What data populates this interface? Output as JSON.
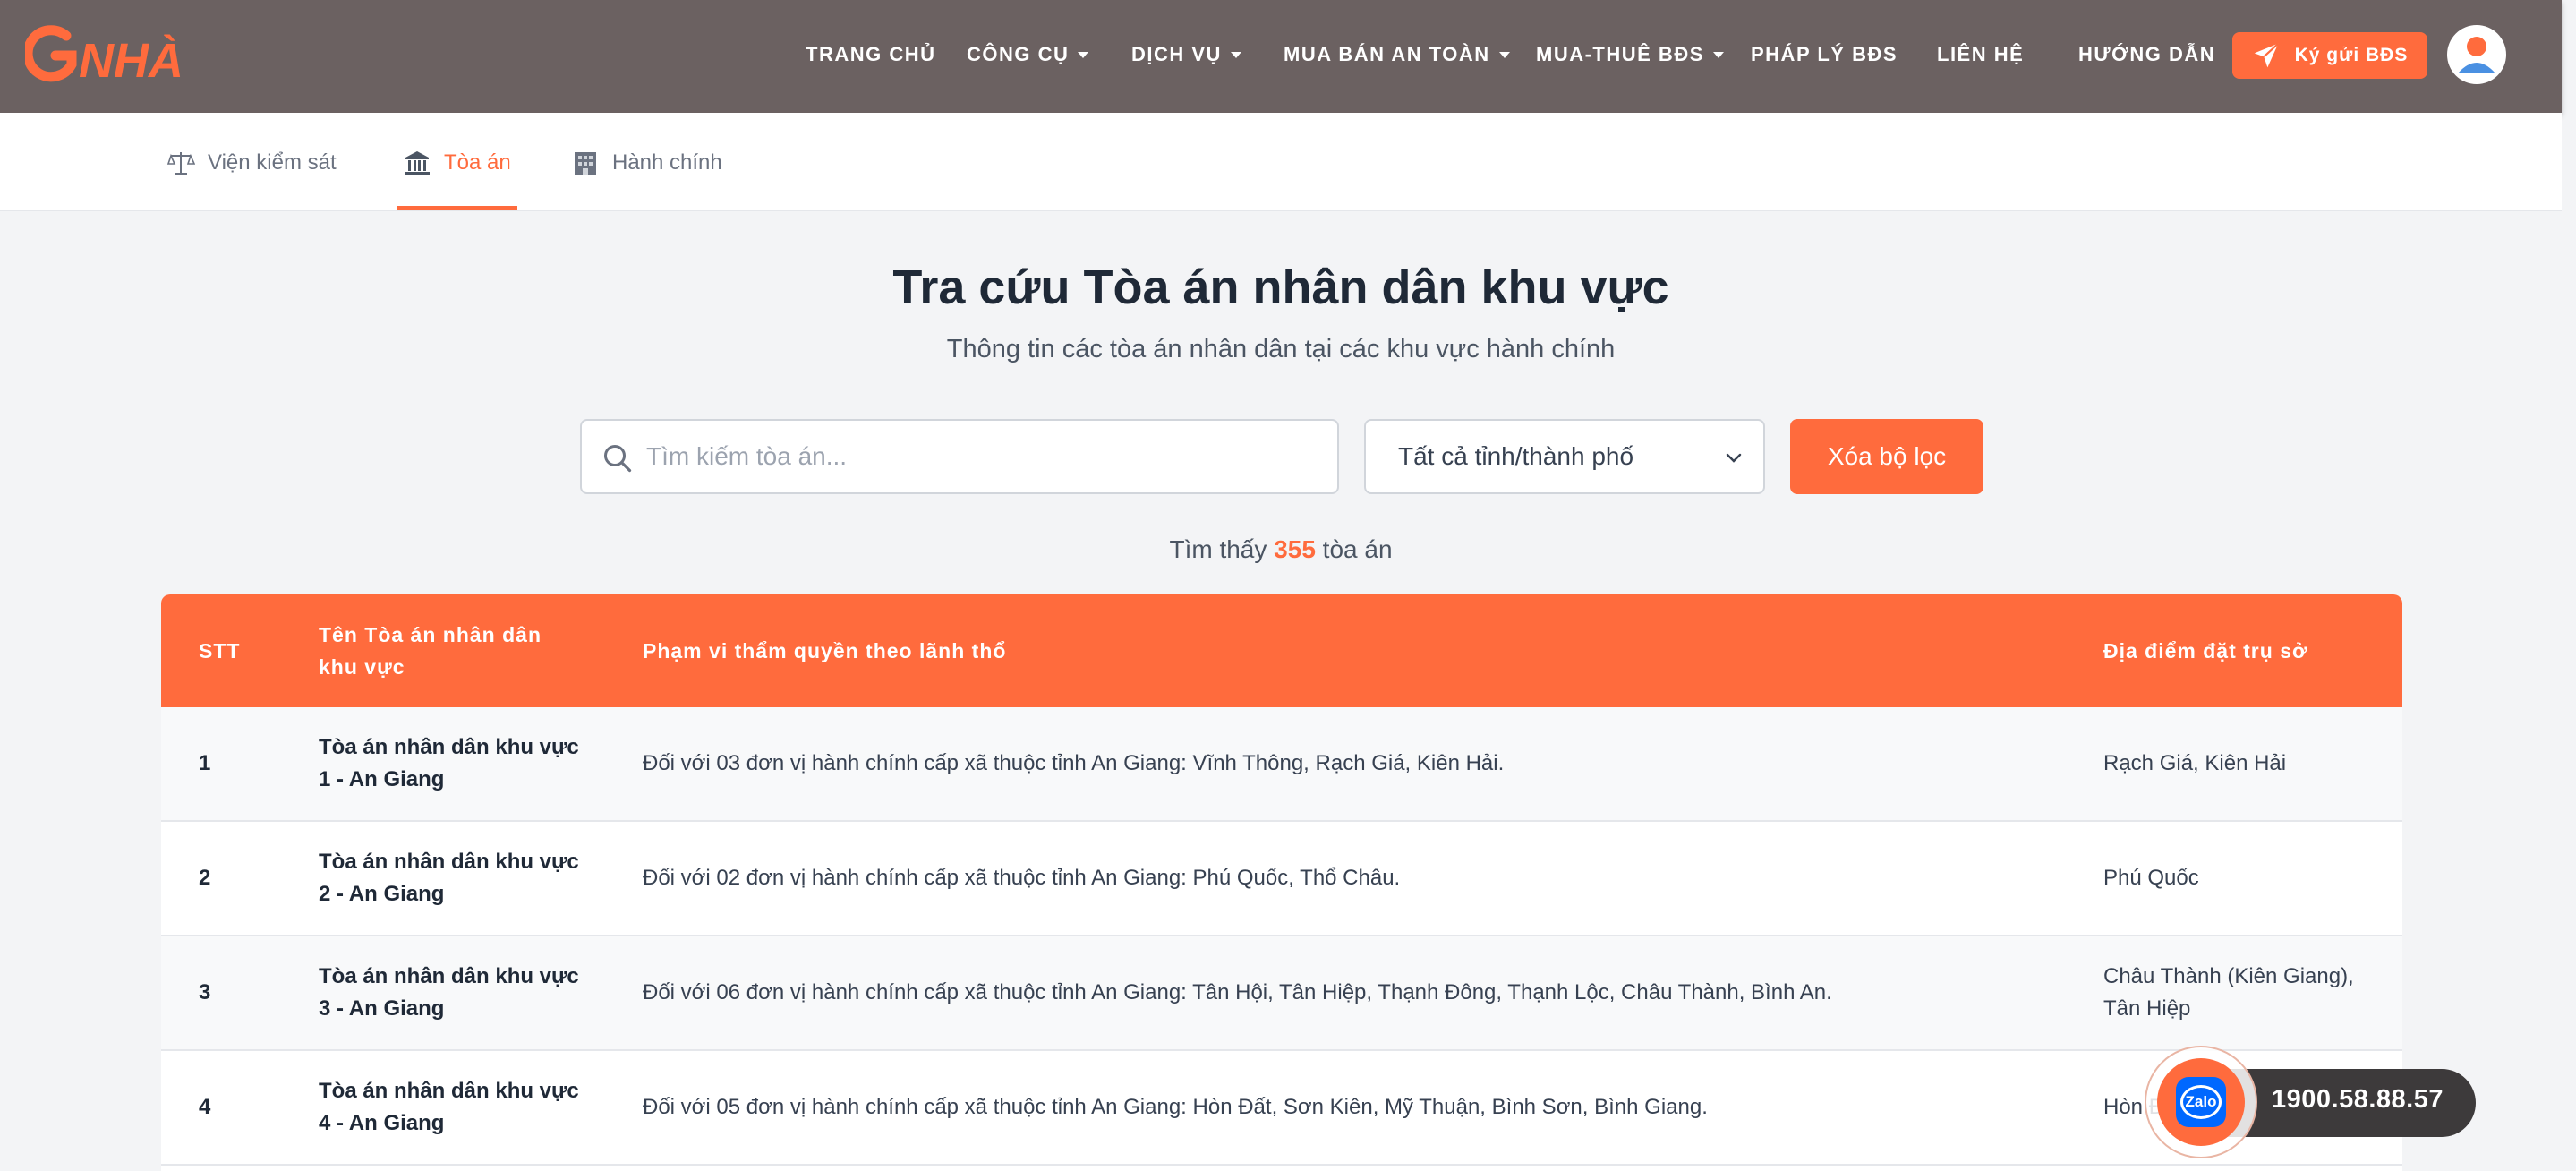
{
  "header": {
    "logo_text": "GNHÀ",
    "nav": [
      {
        "label": "TRANG CHỦ",
        "dropdown": false
      },
      {
        "label": "CÔNG CỤ",
        "dropdown": true
      },
      {
        "label": "DỊCH VỤ",
        "dropdown": true
      },
      {
        "label": "MUA BÁN AN TOÀN",
        "dropdown": true
      },
      {
        "label": "MUA-THUÊ BĐS",
        "dropdown": true
      },
      {
        "label": "PHÁP LÝ BĐS",
        "dropdown": false
      },
      {
        "label": "LIÊN HỆ",
        "dropdown": false
      },
      {
        "label": "HƯỚNG DẪN",
        "dropdown": false
      }
    ],
    "cta_label": "Ký gửi BĐS",
    "cta_icon": "send-icon",
    "avatar_icon": "user-icon"
  },
  "tabs": [
    {
      "label": "Viện kiểm sát",
      "icon": "scale-icon",
      "active": false
    },
    {
      "label": "Tòa án",
      "icon": "courthouse-icon",
      "active": true
    },
    {
      "label": "Hành chính",
      "icon": "building-icon",
      "active": false
    }
  ],
  "page": {
    "title": "Tra cứu Tòa án nhân dân khu vực",
    "subtitle": "Thông tin các tòa án nhân dân tại các khu vực hành chính"
  },
  "filters": {
    "search_placeholder": "Tìm kiếm tòa án...",
    "search_value": "",
    "province_selected": "Tất cả tỉnh/thành phố",
    "clear_label": "Xóa bộ lọc"
  },
  "result": {
    "prefix": "Tìm thấy",
    "count": "355",
    "suffix": "tòa án"
  },
  "table": {
    "headers": {
      "stt": "STT",
      "name": "Tên Tòa án nhân dân khu vực",
      "scope": "Phạm vi thẩm quyền theo lãnh thổ",
      "location": "Địa điểm đặt trụ sở"
    },
    "rows": [
      {
        "stt": "1",
        "name": "Tòa án nhân dân khu vực 1 - An Giang",
        "scope": "Đối với 03 đơn vị hành chính cấp xã thuộc tỉnh An Giang: Vĩnh Thông, Rạch Giá, Kiên Hải.",
        "location": "Rạch Giá, Kiên Hải"
      },
      {
        "stt": "2",
        "name": "Tòa án nhân dân khu vực 2 - An Giang",
        "scope": "Đối với 02 đơn vị hành chính cấp xã thuộc tỉnh An Giang: Phú Quốc, Thổ Châu.",
        "location": "Phú Quốc"
      },
      {
        "stt": "3",
        "name": "Tòa án nhân dân khu vực 3 - An Giang",
        "scope": "Đối với 06 đơn vị hành chính cấp xã thuộc tỉnh An Giang: Tân Hội, Tân Hiệp, Thạnh Đông, Thạnh Lộc, Châu Thành, Bình An.",
        "location": "Châu Thành (Kiên Giang), Tân Hiệp"
      },
      {
        "stt": "4",
        "name": "Tòa án nhân dân khu vực 4 - An Giang",
        "scope": "Đối với 05 đơn vị hành chính cấp xã thuộc tỉnh An Giang: Hòn Đất, Sơn Kiên, Mỹ Thuận, Bình Sơn, Bình Giang.",
        "location": "Hòn Đất"
      }
    ]
  },
  "contact": {
    "zalo_label": "Zalo",
    "phone": "1900.58.88.57"
  },
  "colors": {
    "accent": "#ff6b3d",
    "header_bg": "#6b6161"
  }
}
